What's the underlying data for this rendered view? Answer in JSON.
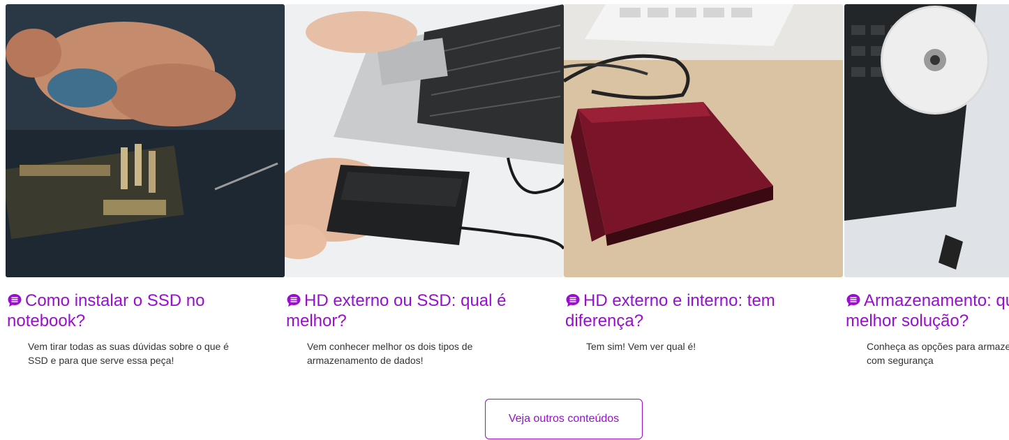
{
  "cards": [
    {
      "title": "Como instalar o SSD no notebook?",
      "description": "Vem tirar todas as suas dúvidas sobre o que é SSD e para que serve essa peça!",
      "image": "hands-installing-ssd-on-motherboard"
    },
    {
      "title": "HD externo ou SSD: qual é melhor?",
      "description": "Vem conhecer melhor os dois tipos de armazenamento de dados!",
      "image": "laptop-with-external-hd"
    },
    {
      "title": "HD externo e interno: tem diferença?",
      "description": "Tem sim! Vem ver qual é!",
      "image": "red-external-hard-drive"
    },
    {
      "title": "Armazenamento: qual a melhor solução?",
      "description": "Conheça as opções para armazenar arquivos com segurança",
      "image": "laptop-with-cd-tray"
    }
  ],
  "icon": "chat-bubble-icon",
  "accent_color": "#9a0ed0",
  "button": {
    "label": "Veja outros conteúdos"
  }
}
